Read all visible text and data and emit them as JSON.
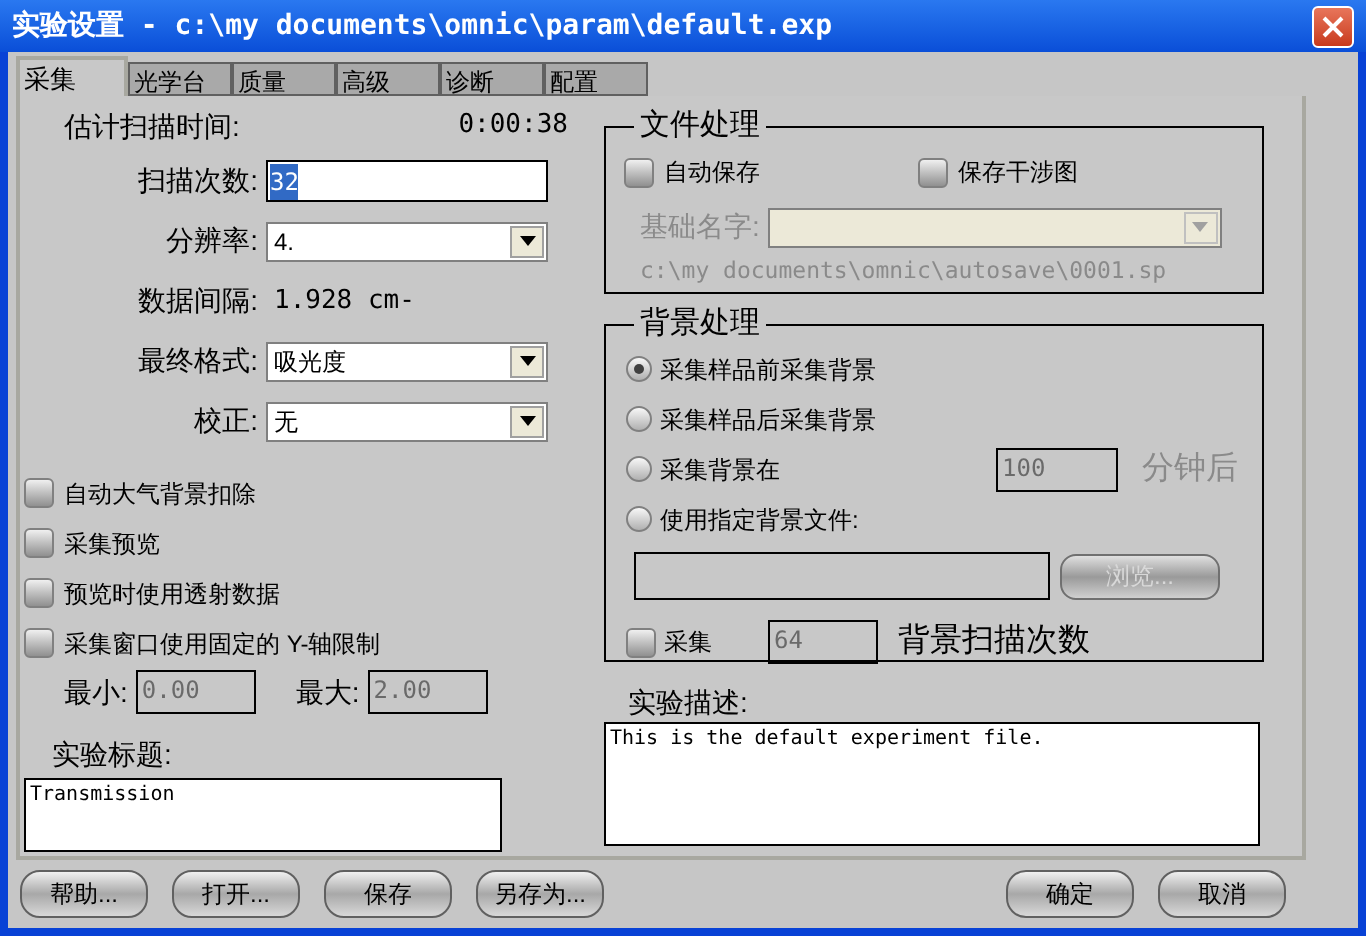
{
  "window": {
    "title": "实验设置 - c:\\my documents\\omnic\\param\\default.exp"
  },
  "tabs": [
    {
      "label": "采集",
      "selected": true
    },
    {
      "label": "光学台",
      "selected": false
    },
    {
      "label": "质量",
      "selected": false
    },
    {
      "label": "高级",
      "selected": false
    },
    {
      "label": "诊断",
      "selected": false
    },
    {
      "label": "配置",
      "selected": false
    }
  ],
  "scan_time": {
    "label": "估计扫描时间:",
    "value": "0:00:38"
  },
  "settings": [
    {
      "kind": "input",
      "label": "扫描次数:",
      "value": "32",
      "highlighted": true
    },
    {
      "kind": "dropdown",
      "label": "分辨率:",
      "value": "4."
    },
    {
      "kind": "text",
      "label": "数据间隔:",
      "value": "1.928 cm-"
    },
    {
      "kind": "dropdown",
      "label": "最终格式:",
      "value": "吸光度"
    },
    {
      "kind": "dropdown",
      "label": "校正:",
      "value": "无"
    }
  ],
  "options": [
    {
      "label": "自动大气背景扣除",
      "checked": false
    },
    {
      "label": "采集预览",
      "checked": false
    },
    {
      "label": "预览时使用透射数据",
      "checked": false
    },
    {
      "label": "采集窗口使用固定的 Y-轴限制",
      "checked": false
    }
  ],
  "y_limits": [
    {
      "label": "最小:",
      "value": "0.00",
      "disabled": true
    },
    {
      "label": "最大:",
      "value": "2.00",
      "disabled": true
    }
  ],
  "experiment_title": {
    "label": "实验标题:",
    "value": "Transmission"
  },
  "file_handling": {
    "title": "文件处理",
    "checkboxes": [
      {
        "label": "自动保存",
        "checked": false
      },
      {
        "label": "保存干涉图",
        "checked": false
      }
    ],
    "base_name": {
      "label": "基础名字:",
      "disabled": true
    },
    "path": "c:\\my documents\\omnic\\autosave\\0001.sp"
  },
  "background": {
    "title": "背景处理",
    "options": [
      {
        "label": "采集样品前采集背景",
        "selected": true
      },
      {
        "label": "采集样品后采集背景",
        "selected": false
      },
      {
        "label": "采集背景在",
        "selected": false
      },
      {
        "label": "使用指定背景文件:",
        "selected": false
      }
    ],
    "interval": {
      "value": "100",
      "unit": "分钟后"
    },
    "browse_button": "浏览...",
    "collect": {
      "label": "采集",
      "checked": false,
      "value": "64",
      "suffix": "背景扫描次数"
    }
  },
  "description": {
    "label": "实验描述:",
    "value": "This is the default experiment file."
  },
  "buttons_left": [
    "帮助...",
    "打开...",
    "保存",
    "另存为..."
  ],
  "buttons_right": [
    "确定",
    "取消"
  ]
}
